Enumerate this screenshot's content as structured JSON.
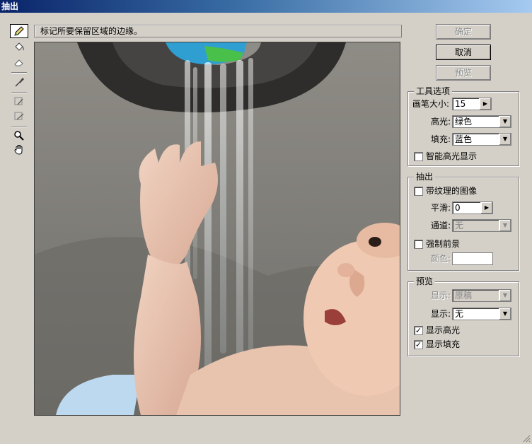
{
  "window": {
    "title": "抽出"
  },
  "hint": {
    "text": "标记所要保留区域的边缘。"
  },
  "tools": [
    {
      "name": "edge-highlighter-tool",
      "active": true
    },
    {
      "name": "fill-tool"
    },
    {
      "name": "eraser-tool"
    },
    {
      "name": "eyedropper-tool"
    },
    {
      "name": "cleanup-tool"
    },
    {
      "name": "edge-touchup-tool"
    },
    {
      "name": "zoom-tool"
    },
    {
      "name": "hand-tool"
    }
  ],
  "buttons": {
    "ok": "确定",
    "cancel": "取消",
    "preview": "预览"
  },
  "tool_options": {
    "title": "工具选项",
    "brush_size_label": "画笔大小:",
    "brush_size_value": "15",
    "highlight_label": "高光:",
    "highlight_value": "绿色",
    "fill_label": "填充:",
    "fill_value": "蓝色",
    "smart_highlight_label": "智能高光显示",
    "smart_highlight_checked": false
  },
  "extraction": {
    "title": "抽出",
    "textured_label": "带纹理的图像",
    "textured_checked": false,
    "smooth_label": "平滑:",
    "smooth_value": "0",
    "channel_label": "通道:",
    "channel_value": "无",
    "force_fg_label": "强制前景",
    "force_fg_checked": false,
    "color_label": "颜色:"
  },
  "preview": {
    "title": "预览",
    "show_label": "显示:",
    "show_value": "原稿",
    "display_label": "显示:",
    "display_value": "无",
    "show_highlight_label": "显示高光",
    "show_highlight_checked": true,
    "show_fill_label": "显示填充",
    "show_fill_checked": true,
    "check_mark": "✓"
  },
  "colors": {
    "titlebar_start": "#0a246a",
    "titlebar_end": "#a6caf0",
    "dialog_bg": "#d4d0c8"
  }
}
